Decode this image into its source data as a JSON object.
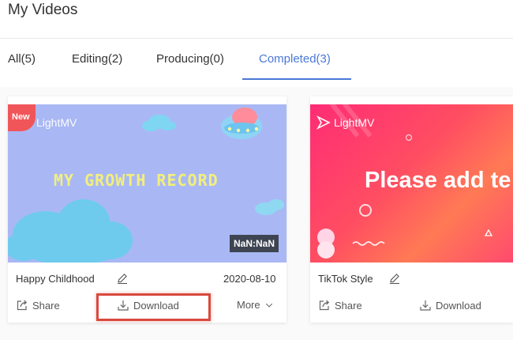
{
  "header": {
    "title": "My Videos"
  },
  "tabs": [
    {
      "label": "All(5)",
      "active": false
    },
    {
      "label": "Editing(2)",
      "active": false
    },
    {
      "label": "Producing(0)",
      "active": false
    },
    {
      "label": "Completed(3)",
      "active": true
    }
  ],
  "colors": {
    "accent": "#4a78d6",
    "highlight": "#d94a3e",
    "new_badge": "#f0555a"
  },
  "videos": [
    {
      "badge": "New",
      "brand": "LightMV",
      "headline": "MY GROWTH RECORD",
      "duration": "NaN:NaN",
      "title": "Happy Childhood",
      "date": "2020-08-10",
      "actions": {
        "share": "Share",
        "download": "Download",
        "more": "More"
      },
      "icons": [
        "edit-icon",
        "share-icon",
        "download-icon",
        "chevron-down-icon"
      ]
    },
    {
      "brand": "LightMV",
      "headline": "Please add te",
      "title": "TikTok Style",
      "actions": {
        "share": "Share",
        "download": "Download"
      },
      "icons": [
        "edit-icon",
        "share-icon",
        "download-icon"
      ]
    }
  ]
}
